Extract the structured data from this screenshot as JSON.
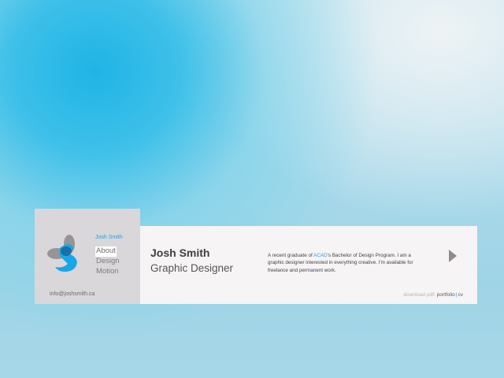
{
  "sidebar": {
    "owner": "Josh Smith",
    "nav": [
      "About",
      "Design",
      "Motion"
    ],
    "active_index": 0,
    "email": "info@joshsmith.ca"
  },
  "profile": {
    "name": "Josh Smith",
    "title": "Graphic Designer",
    "bio_before": "A recent graduate of ",
    "bio_highlight": "ACAD",
    "bio_after": "'s Bachelor of Design Program. I am a graphic designer interested in everything creative. I'm available for freelance and permanent work."
  },
  "downloads": {
    "label": "download pdf:",
    "links": [
      "portfolio",
      "cv"
    ],
    "separator": "|"
  },
  "icons": {
    "logo": "logo-icon",
    "next": "play-arrow-icon"
  },
  "colors": {
    "accent": "#2a9fd8",
    "logo_blue": "#1aa6e6",
    "logo_gray": "#8f8d8f",
    "panel": "#d9d7d9",
    "card": "#f6f4f5"
  }
}
